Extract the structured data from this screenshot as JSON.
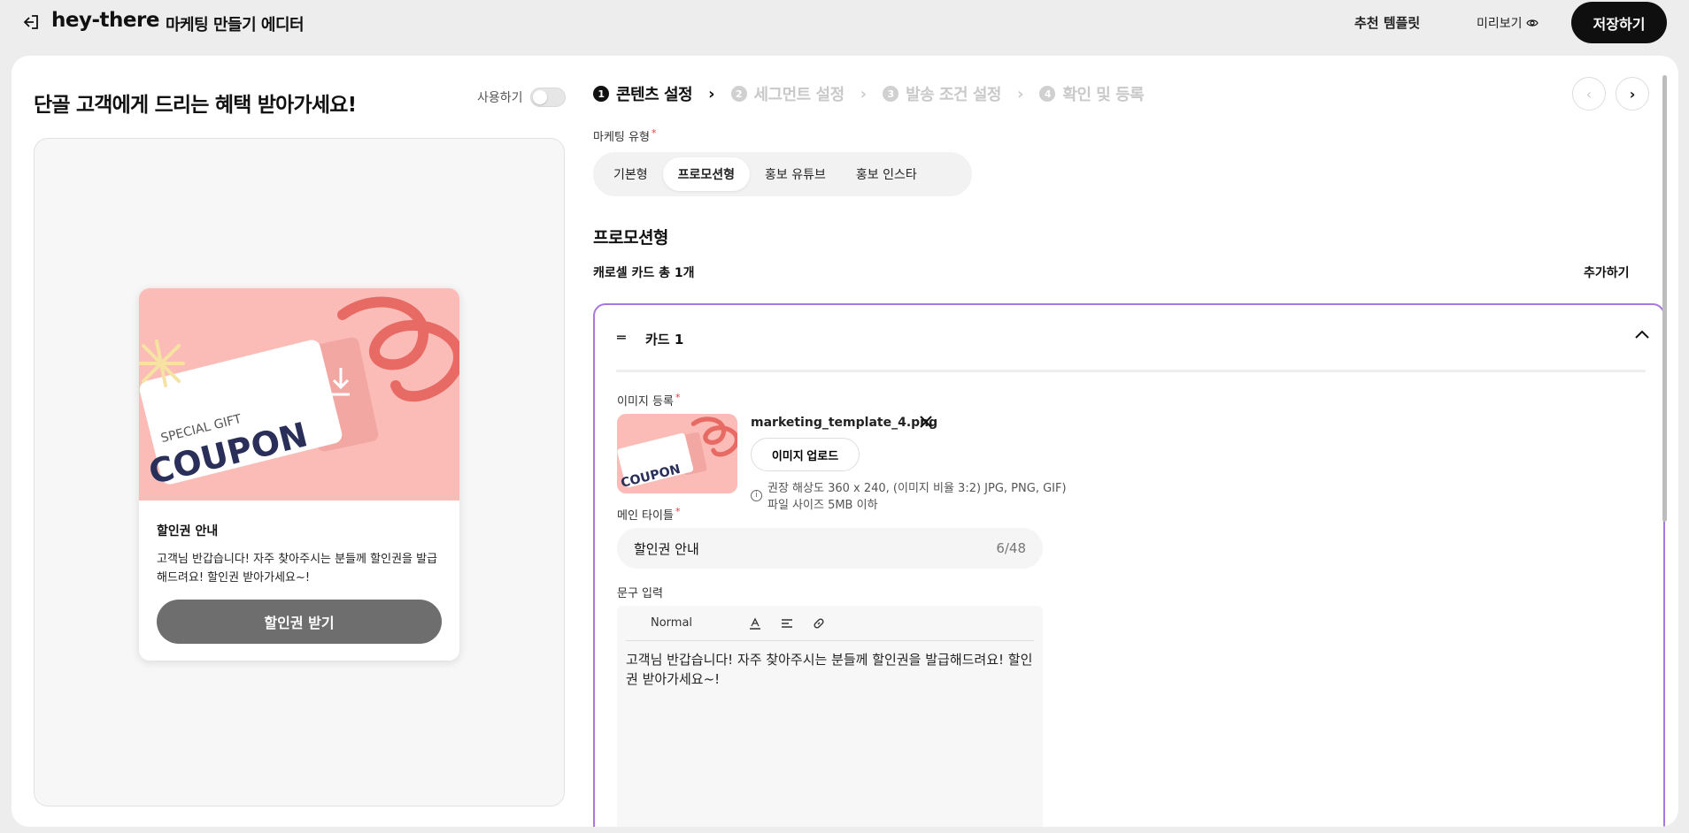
{
  "header": {
    "brand": "hey-there",
    "title": "마케팅 만들기 에디터",
    "templates_label": "추천 템플릿",
    "preview_label": "미리보기",
    "save_label": "저장하기"
  },
  "preview": {
    "heading": "단골 고객에게 드리는 혜택 받아가세요!",
    "toggle_label": "사용하기",
    "toggle_on": false,
    "card": {
      "image_small_text": "SPECIAL GIFT",
      "image_big_text": "COUPON",
      "title": "할인권 안내",
      "text": "고객님 반갑습니다! 자주 찾아주시는 분들께 할인권을 발급해드려요! 할인권 받아가세요~!",
      "button": "할인권 받기"
    }
  },
  "steps": [
    {
      "num": "1",
      "label": "콘텐츠 설정",
      "active": true
    },
    {
      "num": "2",
      "label": "세그먼트 설정",
      "active": false
    },
    {
      "num": "3",
      "label": "발송 조건 설정",
      "active": false
    },
    {
      "num": "4",
      "label": "확인 및 등록",
      "active": false
    }
  ],
  "form": {
    "type_label": "마케팅 유형",
    "types": [
      "기본형",
      "프로모션형",
      "홍보 유튜브",
      "홍보 인스타"
    ],
    "selected_type": "프로모션형",
    "section_title": "프로모션형",
    "carousel_count": "캐로셀 카드 총 1개",
    "add_label": "추가하기",
    "card": {
      "title": "카드 1",
      "image_label": "이미지 등록",
      "file_name": "marketing_template_4.png",
      "upload_label": "이미지 업로드",
      "hint_line1": "권장 해상도 360 x 240, (이미지 비율 3:2) JPG, PNG, GIF)",
      "hint_line2": "파일 사이즈 5MB 이하",
      "main_title_label": "메인 타이틀",
      "main_title_value": "할인권 안내",
      "main_title_count": "6/48",
      "text_label": "문구 입력",
      "editor_format": "Normal",
      "text_value": "고객님 반갑습니다! 자주 찾아주시는 분들께 할인권을 발급해드려요! 할인권 받아가세요~!"
    }
  },
  "colors": {
    "accent_border": "#a977dd",
    "coupon_bg": "#fbbcb7",
    "dark": "#0f0f0f",
    "required": "#e53b3b"
  }
}
